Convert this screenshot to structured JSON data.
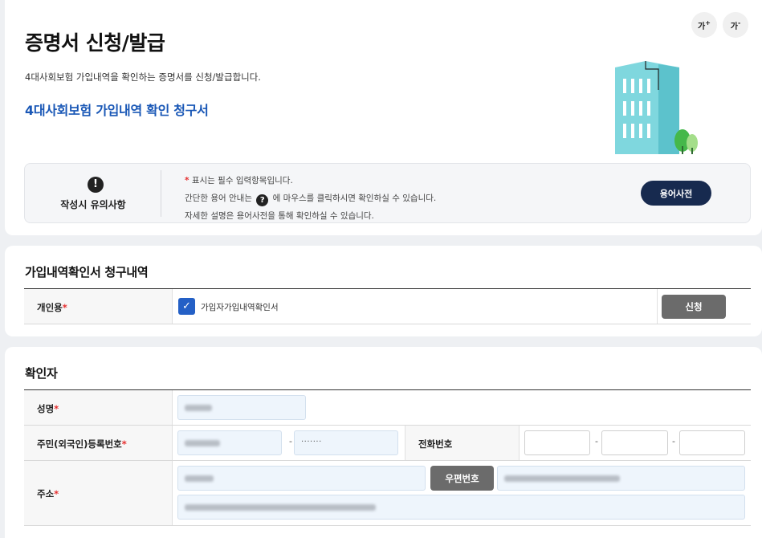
{
  "header": {
    "title": "증명서 신청/발급",
    "description": "4대사회보험 가입내역을 확인하는 증명서를 신청/발급합니다.",
    "subtitle": "4대사회보험 가입내역 확인 청구서",
    "font_up_label": "가",
    "font_up_sup": "+",
    "font_down_label": "가",
    "font_down_sup": "-"
  },
  "notice": {
    "icon": "exclamation-icon",
    "heading": "작성시 유의사항",
    "line1_star": "*",
    "line1": "표시는 필수 입력항목입니다.",
    "line2_before": "간단한 용어 안내는",
    "line2_after": "에 마우스를 클릭하시면 확인하실 수 있습니다.",
    "line3": "자세한 설명은 용어사전을 통해 확인하실 수 있습니다.",
    "dictionary_button": "용어사전"
  },
  "request_section": {
    "title": "가입내역확인서 청구내역",
    "row_label": "개인용",
    "checkbox_label": "가입자가입내역확인서",
    "checkbox_checked": true,
    "apply_button": "신청"
  },
  "confirmer_section": {
    "title": "확인자",
    "name_label": "성명",
    "rrn_label": "주민(외국인)등록번호",
    "rrn_back_mask": "·······",
    "phone_label": "전화번호",
    "address_label": "주소",
    "zip_button": "우편번호",
    "required_mark": "*",
    "separator": "-"
  },
  "colors": {
    "accent_blue": "#1957b6",
    "dictionary_button": "#172a4f",
    "required": "#e52d2d",
    "gray_button": "#6b6b6b"
  }
}
